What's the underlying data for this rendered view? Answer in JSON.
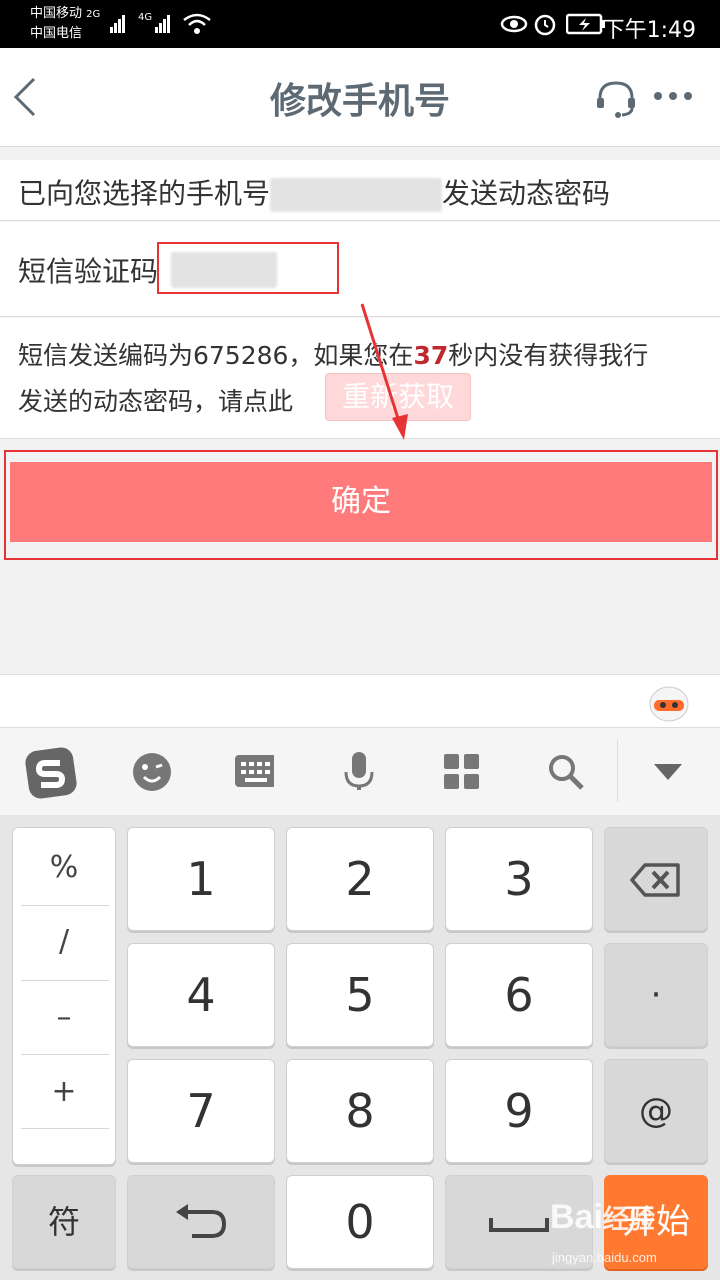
{
  "status_bar": {
    "carrier_1": "中国移动",
    "carrier_1_net": "2G",
    "carrier_2": "中国电信",
    "carrier_2_net": "4G",
    "time": "下午1:49"
  },
  "nav": {
    "title": "修改手机号"
  },
  "send_notice": {
    "prefix": "已向您选择的手机号",
    "suffix": "发送动态密码"
  },
  "sms_code": {
    "label": "短信验证码",
    "value": ""
  },
  "info": {
    "part1": "短信发送编码为675286，如果您在",
    "seconds": "37",
    "part2": "秒内没有获得我行",
    "line2": "发送的动态密码，请点此",
    "resend_label": "重新获取"
  },
  "confirm_label": "确定",
  "keyboard": {
    "symbols": [
      "%",
      "/",
      "–",
      "+"
    ],
    "digits": [
      "1",
      "2",
      "3",
      "4",
      "5",
      "6",
      "7",
      "8",
      "9",
      "0"
    ],
    "dot": "·",
    "at": "@",
    "fu": "符",
    "go": "开始"
  },
  "watermark": {
    "brand": "Bai",
    "brand2": "经验",
    "url": "jingyan.baidu.com"
  },
  "colors": {
    "accent": "#ff7b7b",
    "countdown": "#c0282d",
    "go_key": "#ff7a30",
    "annotation": "#e63434"
  }
}
